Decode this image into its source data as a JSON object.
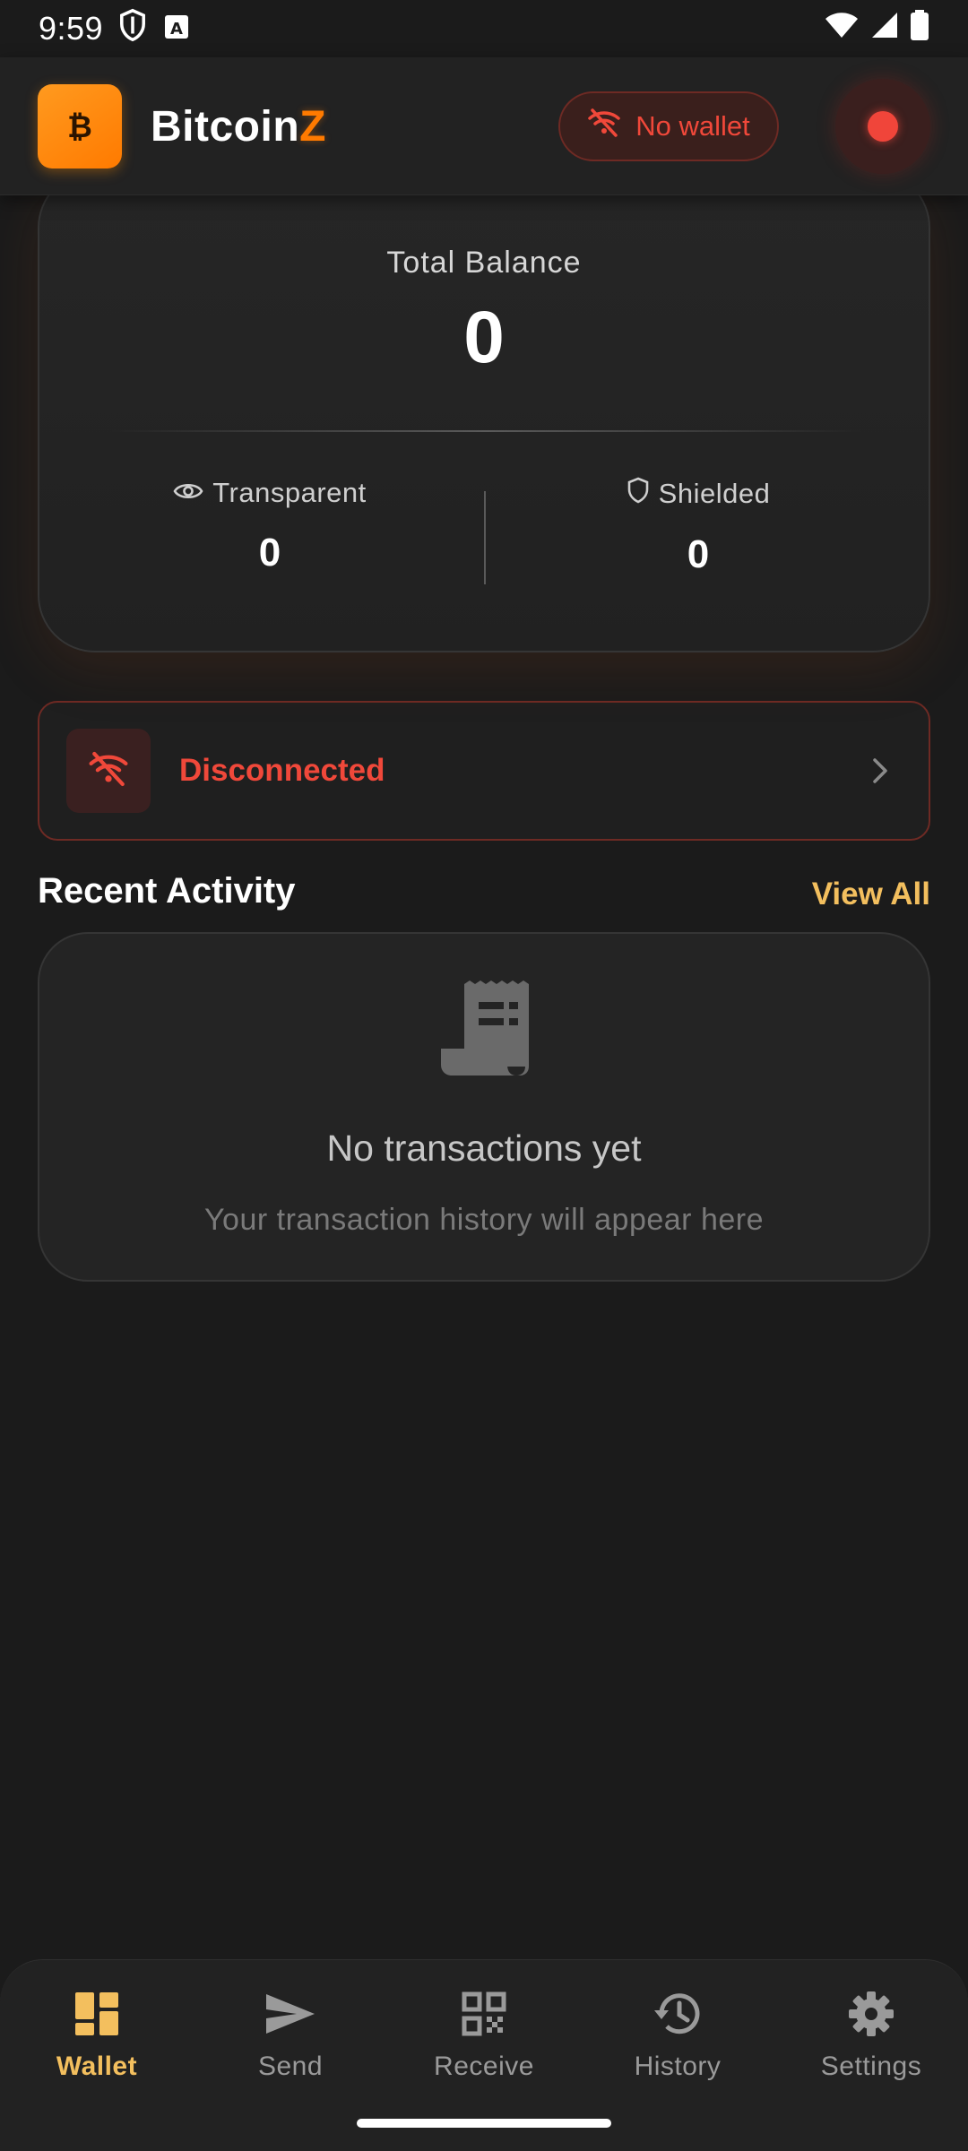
{
  "status_bar": {
    "time": "9:59",
    "left_icons": [
      "shield-icon",
      "font-a-icon"
    ],
    "right_icons": [
      "wifi-icon",
      "cellular-signal-icon",
      "battery-icon"
    ]
  },
  "header": {
    "app_name_main": "Bitcoin",
    "app_name_accent": "Z",
    "logo_symbol": "₿",
    "wallet_status": "No wallet",
    "accent_color": "#ff7a00",
    "error_color": "#f0483a"
  },
  "balance": {
    "label": "Total Balance",
    "total": "0",
    "transparent": {
      "label": "Transparent",
      "value": "0",
      "icon": "eye-icon"
    },
    "shielded": {
      "label": "Shielded",
      "value": "0",
      "icon": "shield-outline-icon"
    }
  },
  "connection": {
    "status": "Disconnected",
    "icon": "wifi-off-icon"
  },
  "recent_activity": {
    "title": "Recent Activity",
    "view_all": "View All",
    "empty_title": "No transactions yet",
    "empty_subtitle": "Your transaction history will appear here",
    "empty_icon": "receipt-icon"
  },
  "nav": {
    "active": "Wallet",
    "active_color": "#f3bf5e",
    "items": [
      {
        "label": "Wallet",
        "icon": "dashboard-icon"
      },
      {
        "label": "Send",
        "icon": "send-icon"
      },
      {
        "label": "Receive",
        "icon": "qr-code-icon"
      },
      {
        "label": "History",
        "icon": "history-icon"
      },
      {
        "label": "Settings",
        "icon": "gear-icon"
      }
    ]
  }
}
